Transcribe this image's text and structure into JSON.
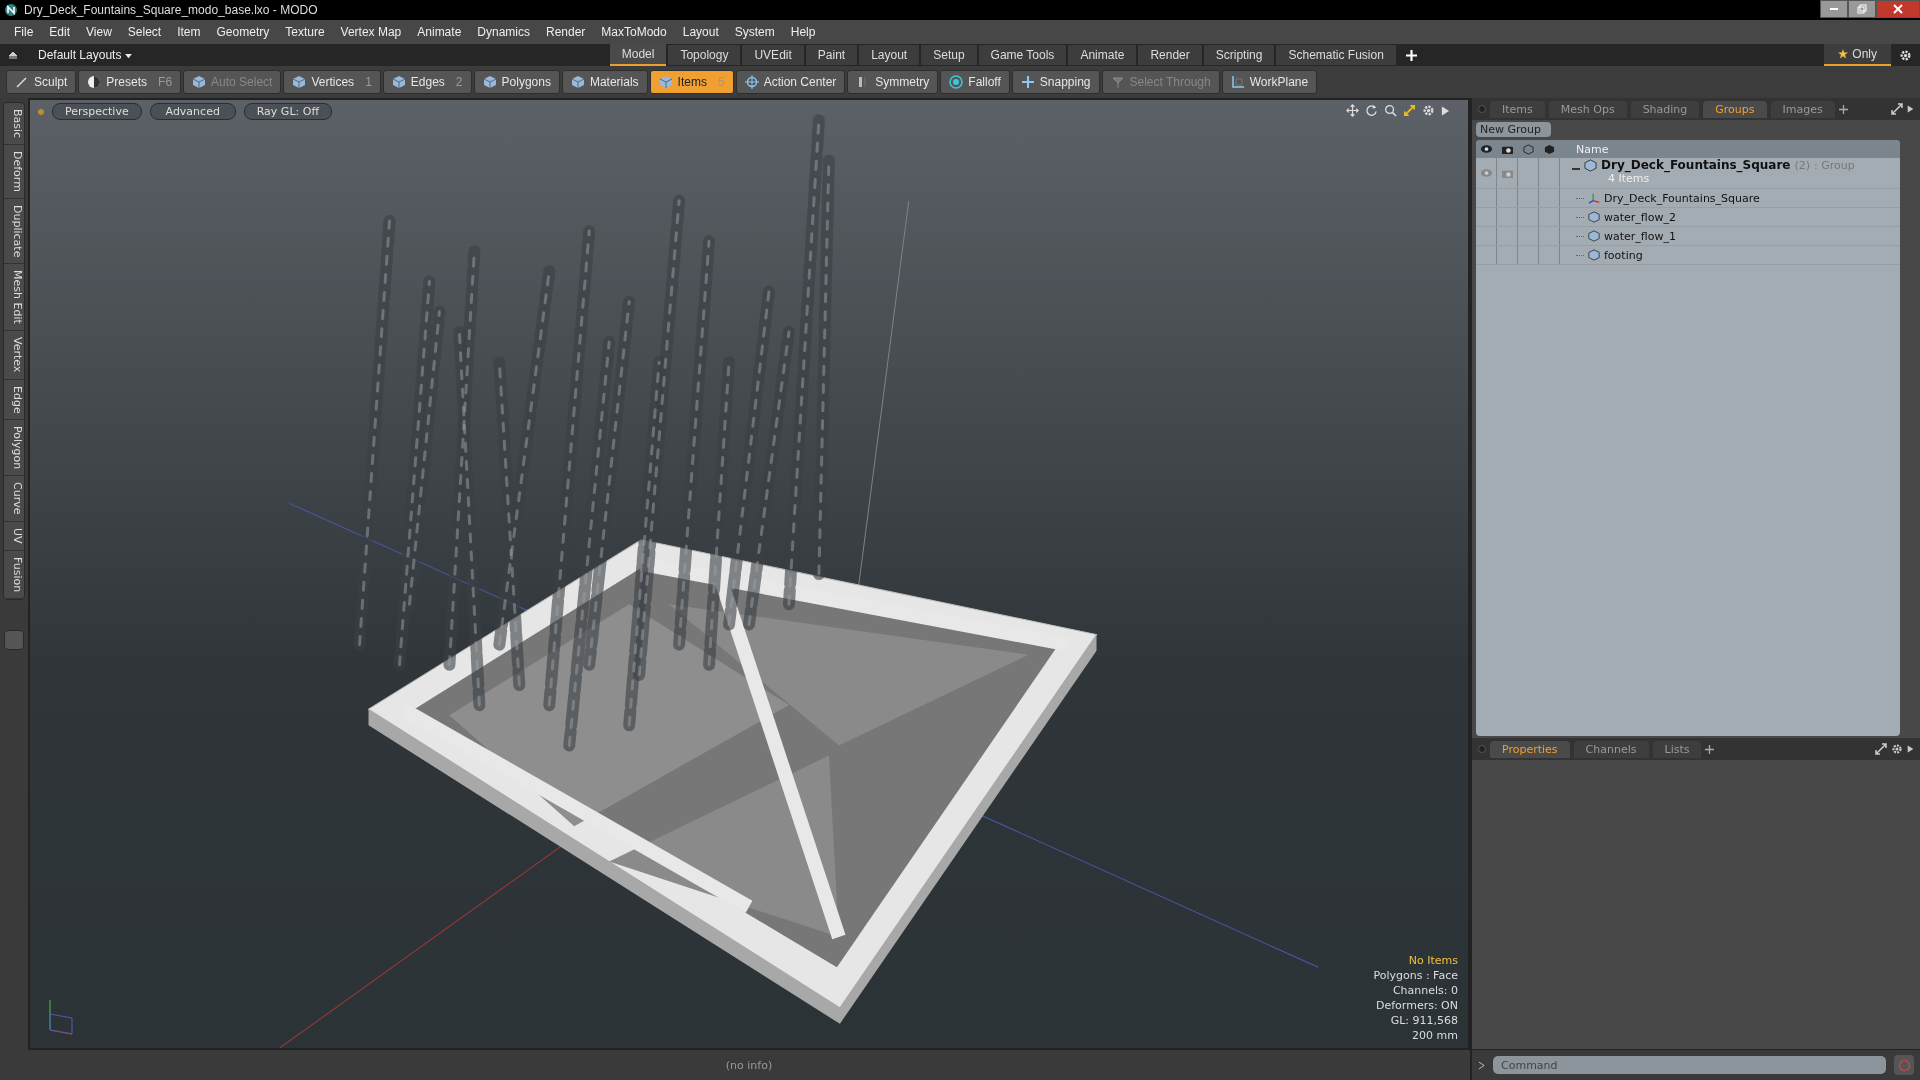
{
  "window": {
    "title": "Dry_Deck_Fountains_Square_modo_base.lxo - MODO"
  },
  "menu": [
    "File",
    "Edit",
    "View",
    "Select",
    "Item",
    "Geometry",
    "Texture",
    "Vertex Map",
    "Animate",
    "Dynamics",
    "Render",
    "MaxToModo",
    "Layout",
    "System",
    "Help"
  ],
  "layouts": {
    "label": "Default Layouts",
    "only": "Only",
    "tabs": [
      {
        "label": "Model",
        "selected": true
      },
      {
        "label": "Topology",
        "selected": false
      },
      {
        "label": "UVEdit",
        "selected": false
      },
      {
        "label": "Paint",
        "selected": false
      },
      {
        "label": "Layout",
        "selected": false
      },
      {
        "label": "Setup",
        "selected": false
      },
      {
        "label": "Game Tools",
        "selected": false
      },
      {
        "label": "Animate",
        "selected": false
      },
      {
        "label": "Render",
        "selected": false
      },
      {
        "label": "Scripting",
        "selected": false
      },
      {
        "label": "Schematic Fusion",
        "selected": false
      }
    ]
  },
  "toolbar": [
    {
      "kind": "brush",
      "label": "Sculpt",
      "selected": false,
      "disabled": false
    },
    {
      "kind": "presets",
      "label": "Presets",
      "shortcut": "F6",
      "selected": false,
      "disabled": false
    },
    {
      "kind": "cube",
      "label": "Auto Select",
      "selected": false,
      "disabled": true
    },
    {
      "kind": "cube",
      "label": "Vertices",
      "shortcut": "1",
      "selected": false,
      "disabled": false
    },
    {
      "kind": "cube",
      "label": "Edges",
      "shortcut": "2",
      "selected": false,
      "disabled": false
    },
    {
      "kind": "cube",
      "label": "Polygons",
      "selected": false,
      "disabled": false
    },
    {
      "kind": "cube",
      "label": "Materials",
      "selected": false,
      "disabled": false
    },
    {
      "kind": "cube",
      "label": "Items",
      "shortcut": "5",
      "selected": true,
      "disabled": false
    },
    {
      "kind": "target",
      "label": "Action Center",
      "selected": false,
      "disabled": false
    },
    {
      "kind": "symmetry",
      "label": "Symmetry",
      "selected": false,
      "disabled": false
    },
    {
      "kind": "falloff",
      "label": "Falloff",
      "selected": false,
      "disabled": false
    },
    {
      "kind": "snap",
      "label": "Snapping",
      "selected": false,
      "disabled": false
    },
    {
      "kind": "through",
      "label": "Select Through",
      "selected": false,
      "disabled": true
    },
    {
      "kind": "workplane",
      "label": "WorkPlane",
      "selected": false,
      "disabled": false
    }
  ],
  "left_tabs": [
    "Basic",
    "Deform",
    "Duplicate",
    "Mesh Edit",
    "Vertex",
    "Edge",
    "Polygon",
    "Curve",
    "UV",
    "Fusion"
  ],
  "viewport": {
    "tabs": [
      "Perspective",
      "Advanced",
      "Ray GL: Off"
    ],
    "info": [
      {
        "kind": "highlight",
        "text": "No Items"
      },
      {
        "kind": "normal",
        "text": "Polygons : Face"
      },
      {
        "kind": "normal",
        "text": "Channels: 0"
      },
      {
        "kind": "normal",
        "text": "Deformers: ON"
      },
      {
        "kind": "normal",
        "text": "GL: 911,568"
      },
      {
        "kind": "normal",
        "text": "200 mm"
      }
    ]
  },
  "status_bar": {
    "text": "(no info)"
  },
  "groups_panel": {
    "tabs": [
      {
        "label": "Items",
        "selected": false
      },
      {
        "label": "Mesh Ops",
        "selected": false
      },
      {
        "label": "Shading",
        "selected": false
      },
      {
        "label": "Groups",
        "selected": true
      },
      {
        "label": "Images",
        "selected": false
      }
    ],
    "new_group": "New Group",
    "column": "Name",
    "group": {
      "name": "Dry_Deck_Fountains_Square",
      "count": "(2)",
      "type": ": Group",
      "subtitle": "4 Items",
      "expanded": true,
      "children": [
        {
          "kind": "locator",
          "name": "Dry_Deck_Fountains_Square"
        },
        {
          "kind": "mesh",
          "name": "water_flow_2"
        },
        {
          "kind": "mesh",
          "name": "water_flow_1"
        },
        {
          "kind": "mesh",
          "name": "footing"
        }
      ]
    }
  },
  "properties_panel": {
    "tabs": [
      {
        "label": "Properties",
        "selected": true
      },
      {
        "label": "Channels",
        "selected": false
      },
      {
        "label": "Lists",
        "selected": false
      }
    ]
  },
  "command": {
    "placeholder": "Command"
  }
}
